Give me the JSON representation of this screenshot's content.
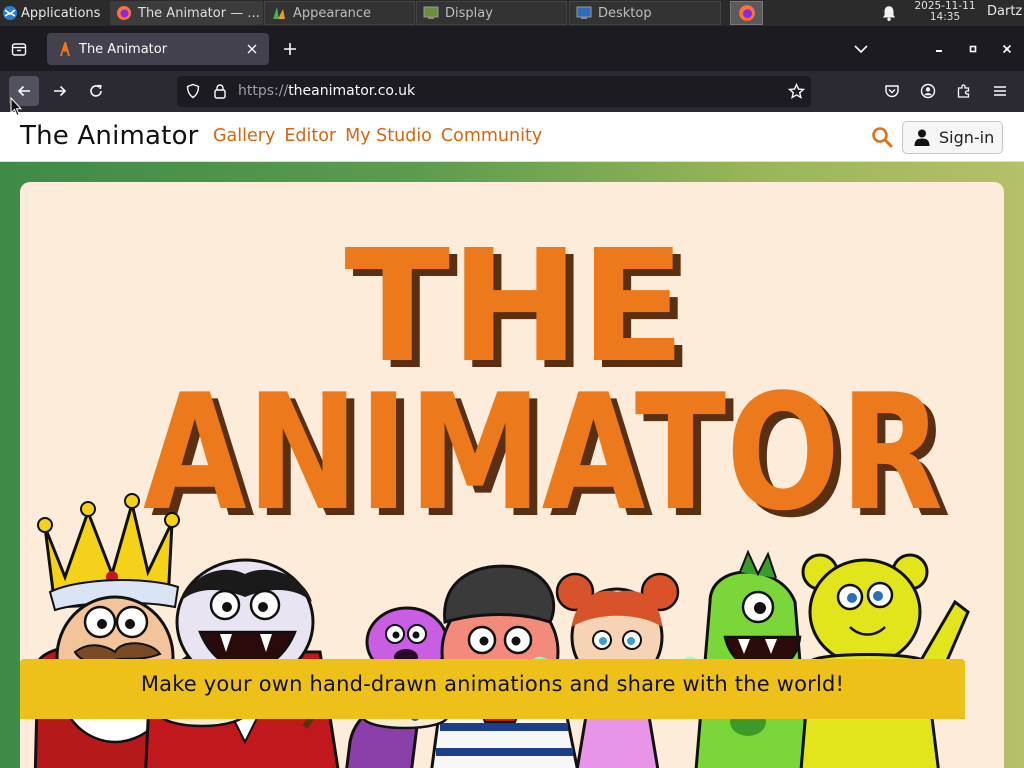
{
  "taskbar": {
    "applications_label": "Applications",
    "tasks": [
      {
        "label": "The Animator — ..."
      },
      {
        "label": "Appearance"
      },
      {
        "label": "Display"
      },
      {
        "label": "Desktop"
      }
    ],
    "clock_date": "2025-11-11",
    "clock_time": "14:35",
    "user": "Dartz"
  },
  "browser": {
    "tab_title": "The Animator",
    "url_scheme": "https://",
    "url_host": "theanimator.co.uk"
  },
  "site": {
    "brand": "The Animator",
    "nav": [
      "Gallery",
      "Editor",
      "My Studio",
      "Community"
    ],
    "signin_label": "Sign-in",
    "hero_title_line1": "THE",
    "hero_title_line2": "ANIMATOR",
    "tagline": "Make your own hand-drawn animations and share with the world!"
  },
  "colors": {
    "accent_orange": "#ec7a1c",
    "brand_brown": "#5a2f12",
    "tagline_yellow": "#edc01a",
    "card_cream": "#fcecd9"
  }
}
